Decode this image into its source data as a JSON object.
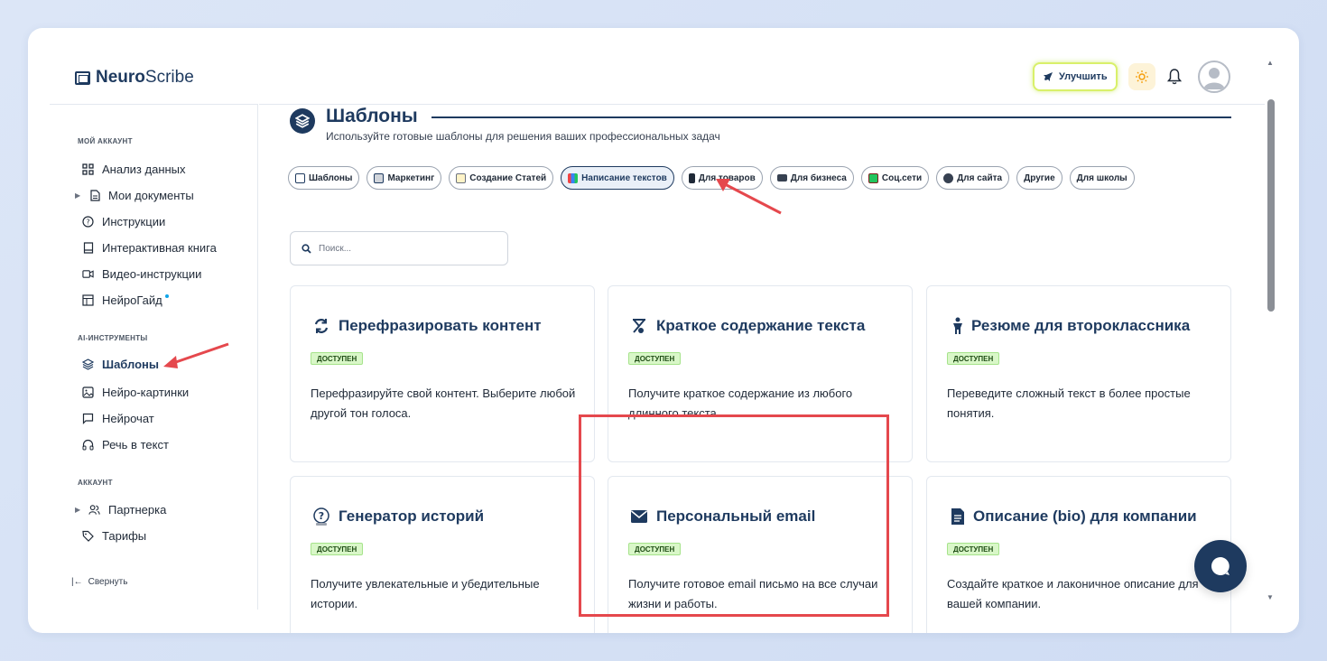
{
  "app": {
    "logo_bold": "Neuro",
    "logo_rest": "Scribe"
  },
  "header": {
    "upgrade_label": "Улучшить"
  },
  "sidebar": {
    "sections": {
      "account": "МОЙ АККАУНТ",
      "ai_tools": "AI-ИНСТРУМЕНТЫ",
      "account2": "АККАУНТ"
    },
    "items": [
      {
        "label": "Анализ данных",
        "icon": "grid-icon"
      },
      {
        "label": "Мои документы",
        "icon": "document-icon"
      },
      {
        "label": "Инструкции",
        "icon": "help-circle-icon"
      },
      {
        "label": "Интерактивная книга",
        "icon": "book-icon"
      },
      {
        "label": "Видео-инструкции",
        "icon": "video-icon"
      },
      {
        "label": "НейроГайд",
        "icon": "guide-icon"
      },
      {
        "label": "Шаблоны",
        "icon": "layers-icon"
      },
      {
        "label": "Нейро-картинки",
        "icon": "image-icon"
      },
      {
        "label": "Нейрочат",
        "icon": "chat-icon"
      },
      {
        "label": "Речь в текст",
        "icon": "headphones-icon"
      },
      {
        "label": "Партнерка",
        "icon": "users-icon"
      },
      {
        "label": "Тарифы",
        "icon": "tag-icon"
      }
    ],
    "collapse_label": "Свернуть"
  },
  "main": {
    "title": "Шаблоны",
    "subtitle": "Используйте готовые шаблоны для решения ваших профессиональных задач",
    "tabs": [
      {
        "label": "Шаблоны"
      },
      {
        "label": "Маркетинг"
      },
      {
        "label": "Создание Статей"
      },
      {
        "label": "Написание текстов"
      },
      {
        "label": "Для товаров"
      },
      {
        "label": "Для бизнеса"
      },
      {
        "label": "Соц.сети"
      },
      {
        "label": "Для сайта"
      },
      {
        "label": "Другие"
      },
      {
        "label": "Для школы"
      }
    ],
    "search_placeholder": "Поиск...",
    "cards": [
      {
        "title": "Перефразировать контент",
        "badge": "ДОСТУПЕН",
        "desc": "Перефразируйте свой контент. Выберите любой другой тон голоса."
      },
      {
        "title": "Краткое содержание текста",
        "badge": "ДОСТУПЕН",
        "desc": "Получите краткое содержание из любого длинного текста."
      },
      {
        "title": "Резюме для второклассника",
        "badge": "ДОСТУПЕН",
        "desc": "Переведите сложный текст в более простые понятия."
      },
      {
        "title": "Генератор историй",
        "badge": "ДОСТУПЕН",
        "desc": "Получите увлекательные и убедительные истории."
      },
      {
        "title": "Персональный email",
        "badge": "ДОСТУПЕН",
        "desc": "Получите готовое email письмо на все случаи жизни и работы."
      },
      {
        "title": "Описание (bio) для компании",
        "badge": "ДОСТУПЕН",
        "desc": "Создайте краткое и лаконичное описание для вашей компании."
      }
    ]
  },
  "colors": {
    "brand": "#1e3a5f",
    "badge_bg": "#d9f7c8",
    "highlight": "#e5484d"
  }
}
